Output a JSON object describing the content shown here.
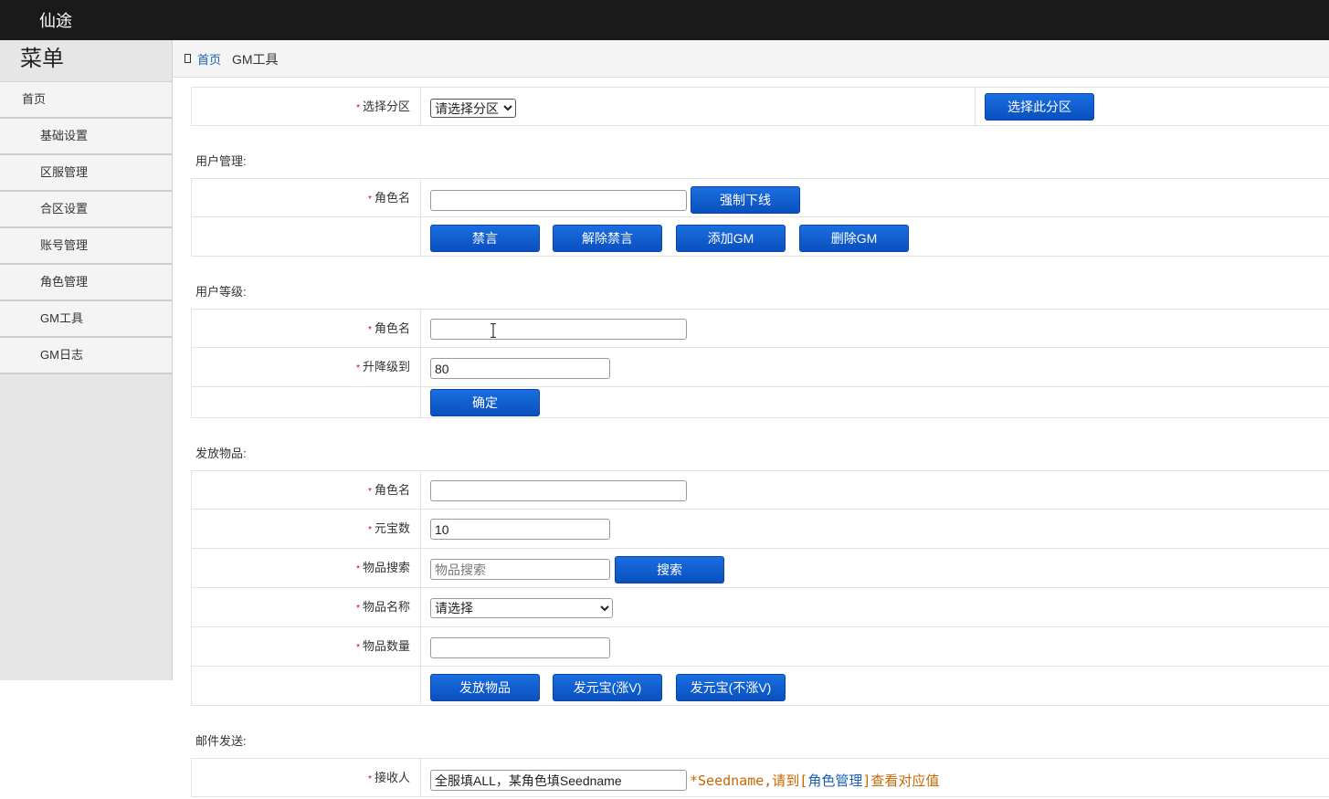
{
  "app": {
    "title": "仙途"
  },
  "sidebar": {
    "title": "菜单",
    "items": [
      {
        "label": "首页"
      },
      {
        "label": "基础设置"
      },
      {
        "label": "区服管理"
      },
      {
        "label": "合区设置"
      },
      {
        "label": "账号管理"
      },
      {
        "label": "角色管理"
      },
      {
        "label": "GM工具"
      },
      {
        "label": "GM日志"
      }
    ]
  },
  "breadcrumb": {
    "home": "首页",
    "current": "GM工具"
  },
  "zone": {
    "label": "选择分区",
    "select_value": "请选择分区",
    "button": "选择此分区"
  },
  "user_mgmt": {
    "title": "用户管理:",
    "role_label": "角色名",
    "role_value": "",
    "kick_button": "强制下线",
    "mute_button": "禁言",
    "unmute_button": "解除禁言",
    "add_gm_button": "添加GM",
    "del_gm_button": "删除GM"
  },
  "user_level": {
    "title": "用户等级:",
    "role_label": "角色名",
    "role_value": "",
    "level_label": "升降级到",
    "level_value": "80",
    "confirm_button": "确定"
  },
  "items": {
    "title": "发放物品:",
    "role_label": "角色名",
    "role_value": "",
    "yuanbao_label": "元宝数",
    "yuanbao_value": "10",
    "search_label": "物品搜索",
    "search_placeholder": "物品搜索",
    "search_button": "搜索",
    "name_label": "物品名称",
    "name_select": "请选择",
    "qty_label": "物品数量",
    "qty_value": "",
    "send_items_button": "发放物品",
    "send_yb_v_button": "发元宝(涨V)",
    "send_yb_nov_button": "发元宝(不涨V)"
  },
  "mail": {
    "title": "邮件发送:",
    "recipient_label": "接收人",
    "recipient_value": "全服填ALL，某角色填Seedname",
    "hint_prefix": "*Seedname,请到[",
    "hint_link": "角色管理",
    "hint_suffix": "]查看对应值"
  }
}
